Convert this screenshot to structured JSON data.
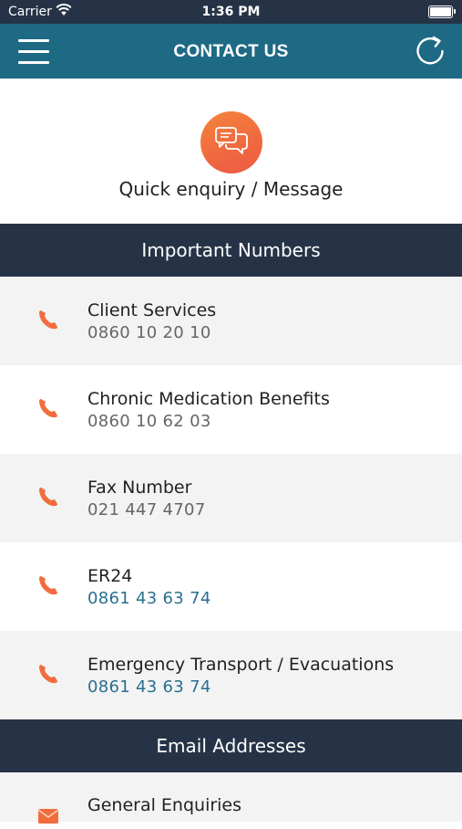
{
  "status_bar": {
    "carrier": "Carrier",
    "time": "1:36 PM"
  },
  "header": {
    "title": "CONTACT US"
  },
  "quick_enquiry": {
    "label": "Quick enquiry / Message"
  },
  "sections": {
    "important_numbers": "Important Numbers",
    "email_addresses": "Email Addresses"
  },
  "contacts": [
    {
      "name": "Client Services",
      "number": "0860 10 20 10"
    },
    {
      "name": "Chronic Medication Benefits",
      "number": "0860 10 62 03"
    },
    {
      "name": "Fax Number",
      "number": "021 447 4707"
    },
    {
      "name": "ER24",
      "number": "0861 43 63 74"
    },
    {
      "name": "Emergency Transport / Evacuations",
      "number": "0861 43 63 74"
    }
  ],
  "emails": [
    {
      "name": "General Enquiries"
    }
  ],
  "colors": {
    "nav": "#1e6a85",
    "section": "#263347",
    "accent": "#f06a3f",
    "link": "#2a6f8f"
  }
}
